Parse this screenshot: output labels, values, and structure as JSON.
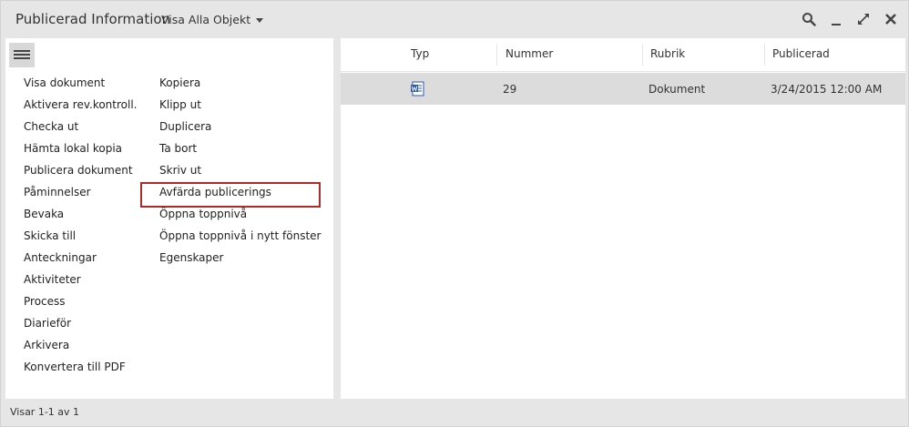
{
  "window": {
    "title": "Publicerad Information",
    "view_select": "Visa Alla Objekt"
  },
  "toolbar": {
    "icons": [
      "search-icon",
      "minimize-icon",
      "expand-icon",
      "close-icon"
    ]
  },
  "menu": {
    "col1": [
      "Visa dokument",
      "Aktivera rev.kontroll.",
      "Checka ut",
      "Hämta lokal kopia",
      "Publicera dokument",
      "Påminnelser",
      "Bevaka",
      "Skicka till",
      "Anteckningar",
      "Aktiviteter",
      "Process",
      "Diarieför",
      "Arkivera",
      "Konvertera till PDF"
    ],
    "col2": [
      "Kopiera",
      "Klipp ut",
      "Duplicera",
      "Ta bort",
      "Skriv ut",
      "Avfärda publicerings",
      "Öppna toppnivå",
      "Öppna toppnivå i nytt fönster",
      "Egenskaper"
    ],
    "selected": "Avfärda publicerings"
  },
  "table": {
    "headers": [
      "Typ",
      "Nummer",
      "Rubrik",
      "Publicerad"
    ],
    "rows": [
      {
        "typ_icon": "word-document-icon",
        "nummer": "29",
        "rubrik": "Dokument",
        "publicerad": "3/24/2015 12:00 AM"
      }
    ]
  },
  "status": {
    "text": "Visar 1-1 av 1"
  },
  "colors": {
    "selected_outline": "#b02a2a",
    "row_highlight": "#dcdcdc",
    "chrome": "#e6e6e6"
  }
}
